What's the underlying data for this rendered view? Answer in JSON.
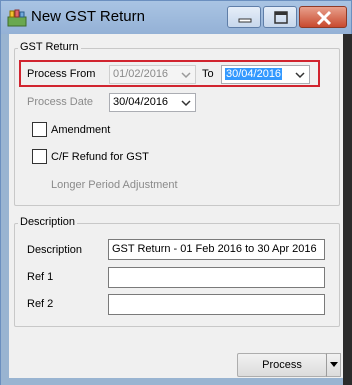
{
  "window": {
    "title": "New GST Return",
    "title_color": "#000000",
    "close_button_color": "#c84a2f"
  },
  "gst_return_group": {
    "label": "GST Return",
    "process_from_label": "Process From",
    "process_from_value": "01/02/2016",
    "to_label": "To",
    "to_value": "30/04/2016",
    "process_date_label": "Process Date",
    "process_date_value": "30/04/2016",
    "amendment_label": "Amendment",
    "amendment_checked": false,
    "cf_refund_label": "C/F Refund for GST",
    "cf_refund_checked": false,
    "longer_period_label": "Longer Period Adjustment",
    "highlight_color": "#d1242f"
  },
  "description_group": {
    "label": "Description",
    "description_label": "Description",
    "description_value": "GST Return - 01 Feb 2016 to 30 Apr 2016",
    "ref1_label": "Ref 1",
    "ref1_value": "",
    "ref2_label": "Ref 2",
    "ref2_value": ""
  },
  "footer": {
    "process_label": "Process"
  }
}
